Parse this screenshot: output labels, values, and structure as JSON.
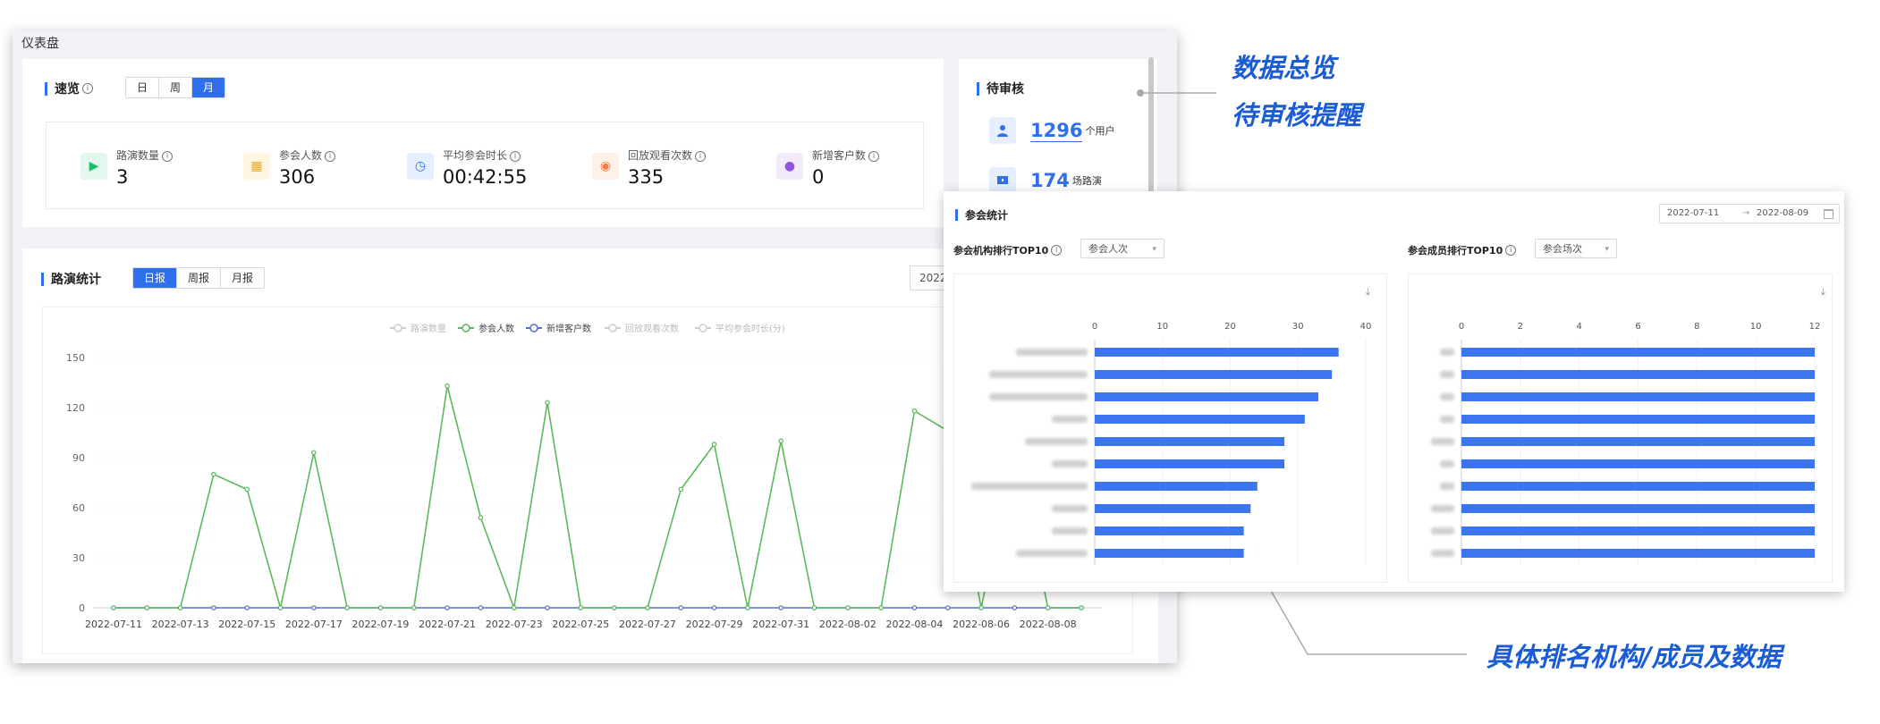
{
  "breadcrumb": "仪表盘",
  "overview": {
    "title": "速览",
    "tabs": [
      {
        "label": "日"
      },
      {
        "label": "周"
      },
      {
        "label": "月"
      }
    ],
    "active_tab": "月",
    "stats": [
      {
        "label": "路演数量",
        "value": "3",
        "icon": "roadshow-icon",
        "color": "#19be6b"
      },
      {
        "label": "参会人数",
        "value": "306",
        "icon": "attendees-icon",
        "color": "#f5a623"
      },
      {
        "label": "平均参会时长",
        "value": "00:42:55",
        "icon": "clock-icon",
        "color": "#2f6fed"
      },
      {
        "label": "回放观看次数",
        "value": "335",
        "icon": "eye-icon",
        "color": "#ff7a45"
      },
      {
        "label": "新增客户数",
        "value": "0",
        "icon": "new-user-icon",
        "color": "#9254de"
      }
    ]
  },
  "pending": {
    "title": "待审核",
    "items": [
      {
        "value": "1296",
        "unit": "个用户",
        "icon": "user-icon"
      },
      {
        "value": "174",
        "unit": "场路演",
        "icon": "roadshow-icon"
      }
    ]
  },
  "roadshow_stats": {
    "title": "路演统计",
    "tabs": [
      {
        "label": "日报"
      },
      {
        "label": "周报"
      },
      {
        "label": "月报"
      }
    ],
    "active_tab": "日报",
    "date_value": "2022-"
  },
  "callouts": {
    "overview": "数据总览",
    "pending": "待审核提醒",
    "ranking": "具体排名机构/成员及数据"
  },
  "attendance": {
    "title": "参会统计",
    "date_start": "2022-07-11",
    "date_arrow": "→",
    "date_end": "2022-08-09",
    "org_title": "参会机构排行TOP10",
    "org_select": "参会人次",
    "member_title": "参会成员排行TOP10",
    "member_select": "参会场次"
  },
  "chart_data": [
    {
      "type": "line",
      "legend": [
        "路演数量",
        "参会人数",
        "新增客户数",
        "回放观看次数",
        "平均参会时长(分)"
      ],
      "legend_active": [
        false,
        true,
        true,
        false,
        false
      ],
      "x": [
        "2022-07-11",
        "2022-07-12",
        "2022-07-13",
        "2022-07-14",
        "2022-07-15",
        "2022-07-16",
        "2022-07-17",
        "2022-07-18",
        "2022-07-19",
        "2022-07-20",
        "2022-07-21",
        "2022-07-22",
        "2022-07-23",
        "2022-07-24",
        "2022-07-25",
        "2022-07-26",
        "2022-07-27",
        "2022-07-28",
        "2022-07-29",
        "2022-07-30",
        "2022-07-31",
        "2022-08-01",
        "2022-08-02",
        "2022-08-03",
        "2022-08-04",
        "2022-08-05",
        "2022-08-06",
        "2022-08-07",
        "2022-08-08",
        "2022-08-09"
      ],
      "x_tick_labels": [
        "2022-07-11",
        "2022-07-13",
        "2022-07-15",
        "2022-07-17",
        "2022-07-19",
        "2022-07-21",
        "2022-07-23",
        "2022-07-25",
        "2022-07-27",
        "2022-07-29",
        "2022-07-31",
        "2022-08-02",
        "2022-08-04",
        "2022-08-06",
        "2022-08-08"
      ],
      "y_ticks": [
        0,
        30,
        60,
        90,
        120,
        150
      ],
      "ylim": [
        0,
        150
      ],
      "series": [
        {
          "name": "参会人数",
          "color": "#5cb85c",
          "values": [
            0,
            0,
            0,
            80,
            71,
            0,
            93,
            0,
            0,
            0,
            133,
            54,
            0,
            123,
            0,
            0,
            0,
            71,
            98,
            0,
            100,
            0,
            0,
            0,
            118,
            106,
            0,
            96,
            0,
            0
          ]
        },
        {
          "name": "新增客户数",
          "color": "#5470c6",
          "values": [
            0,
            0,
            0,
            0,
            0,
            0,
            0,
            0,
            0,
            0,
            0,
            0,
            0,
            0,
            0,
            0,
            0,
            0,
            0,
            0,
            0,
            0,
            0,
            0,
            0,
            0,
            0,
            0,
            0,
            0
          ]
        }
      ]
    },
    {
      "type": "bar",
      "orientation": "horizontal",
      "title": "参会机构排行TOP10",
      "x_ticks": [
        0,
        10,
        20,
        30,
        40
      ],
      "xlim": [
        0,
        40
      ],
      "values": [
        36,
        35,
        33,
        31,
        28,
        28,
        24,
        23,
        22,
        22
      ],
      "color": "#3b76f0"
    },
    {
      "type": "bar",
      "orientation": "horizontal",
      "title": "参会成员排行TOP10",
      "x_ticks": [
        0,
        2,
        4,
        6,
        8,
        10,
        12
      ],
      "xlim": [
        0,
        12
      ],
      "values": [
        12,
        12,
        12,
        12,
        12,
        12,
        12,
        12,
        12,
        12
      ],
      "color": "#3b76f0"
    }
  ]
}
